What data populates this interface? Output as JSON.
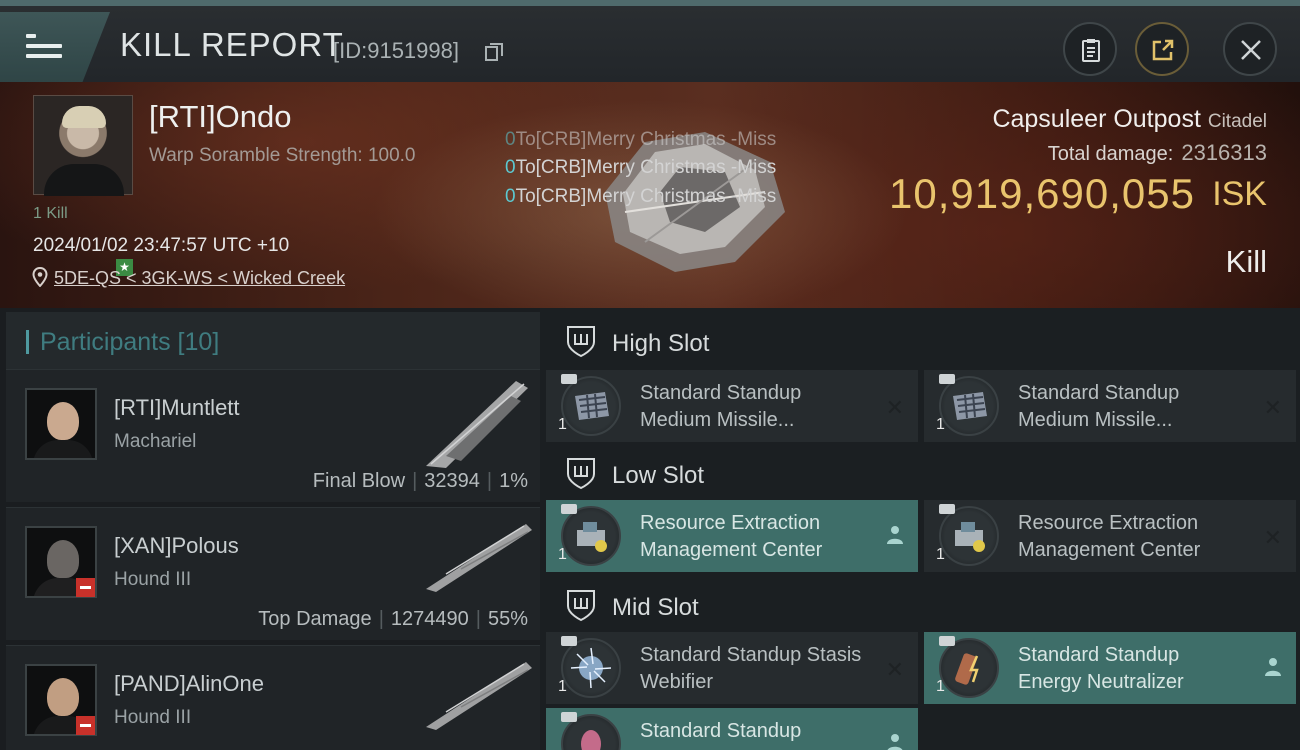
{
  "header": {
    "title": "KILL REPORT",
    "kill_id": "[ID:9151998]"
  },
  "victim": {
    "name": "[RTI]Ondo",
    "warp_scramble": "Warp Soramble Strength: 100.0",
    "kill_count": "1 Kill",
    "datetime": "2024/01/02 23:47:57 UTC +10",
    "location": "5DE-QS < 3GK-WS < Wicked Creek"
  },
  "combat_log": [
    {
      "value": "0",
      "text": "To[CRB]Merry Christmas -Miss"
    },
    {
      "value": "0",
      "text": "To[CRB]Merry Christmas -Miss"
    },
    {
      "value": "0",
      "text": "To[CRB]Merry Christmas -Miss"
    }
  ],
  "structure": {
    "name": "Capsuleer Outpost",
    "class": "Citadel",
    "total_damage_label": "Total damage:",
    "total_damage": "2316313",
    "isk_value": "10,919,690,055",
    "isk_unit": "ISK",
    "result": "Kill"
  },
  "participants": {
    "title": "Participants [10]",
    "items": [
      {
        "name": "[RTI]Muntlett",
        "ship": "Machariel",
        "tag": "Final Blow",
        "damage": "32394",
        "percent": "1%",
        "standing": "neutral"
      },
      {
        "name": "[XAN]Polous",
        "ship": "Hound III",
        "tag": "Top Damage",
        "damage": "1274490",
        "percent": "55%",
        "standing": "hostile"
      },
      {
        "name": "[PAND]AlinOne",
        "ship": "Hound III",
        "tag": "",
        "damage": "",
        "percent": "",
        "standing": "hostile"
      }
    ]
  },
  "slots": {
    "high": {
      "title": "High Slot",
      "modules": [
        {
          "name": "Standard Standup Medium Missile...",
          "qty": "1",
          "status": "destroyed"
        },
        {
          "name": "Standard Standup Medium Missile...",
          "qty": "1",
          "status": "destroyed"
        }
      ]
    },
    "low": {
      "title": "Low Slot",
      "modules": [
        {
          "name": "Resource Extraction Management Center",
          "qty": "1",
          "status": "dropped"
        },
        {
          "name": "Resource Extraction Management Center",
          "qty": "1",
          "status": "destroyed"
        }
      ]
    },
    "mid": {
      "title": "Mid Slot",
      "modules": [
        {
          "name": "Standard Standup Stasis Webifier",
          "qty": "1",
          "status": "destroyed"
        },
        {
          "name": "Standard Standup Energy Neutralizer",
          "qty": "1",
          "status": "dropped"
        },
        {
          "name": "Standard Standup",
          "qty": "1",
          "status": "dropped"
        }
      ]
    }
  },
  "colors": {
    "accent_teal": "#4f9aa0",
    "isk_gold": "#e9c46d",
    "dropped_bg": "#3e6e69",
    "hostile_red": "#c8312a",
    "friendly_green": "#3b8b43"
  },
  "icons": {
    "menu": "hamburger-menu-icon",
    "copy": "copy-icon",
    "clipboard": "clipboard-icon",
    "share": "share-external-icon",
    "close": "close-icon",
    "location": "map-pin-icon",
    "slot": "shield-slot-icon",
    "destroyed": "x-destroyed-icon",
    "dropped": "person-dropped-icon"
  }
}
